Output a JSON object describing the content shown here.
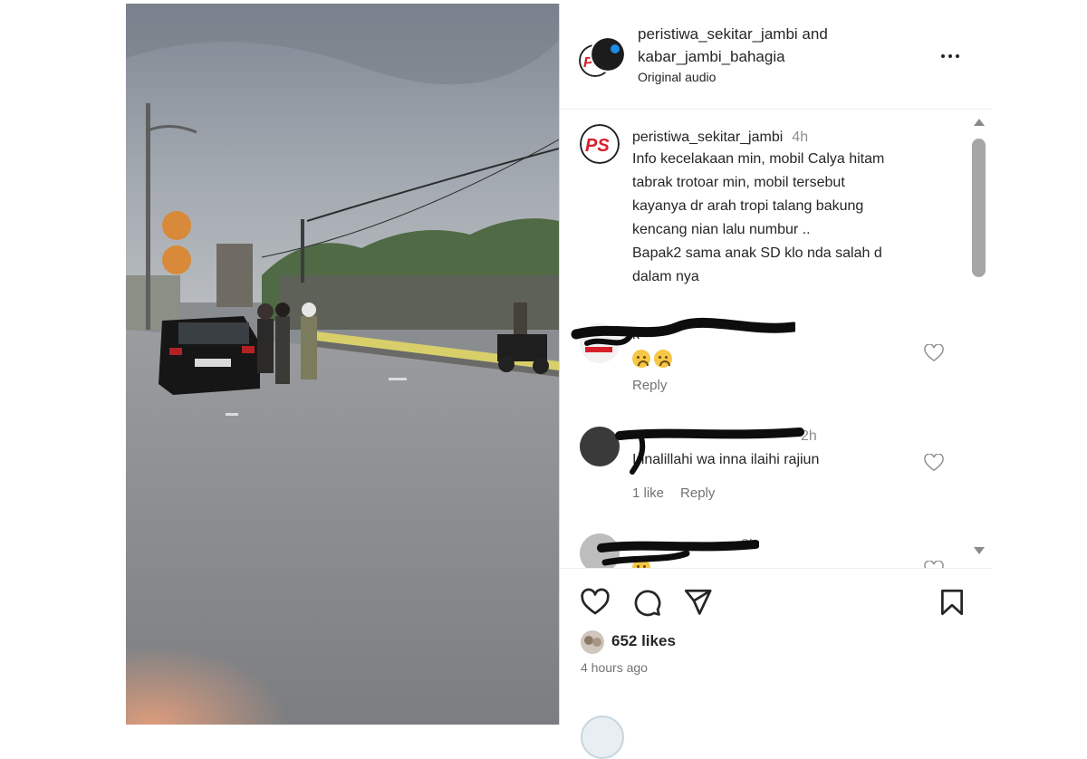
{
  "header": {
    "usernames_line1": "peristiwa_sekitar_jambi and",
    "usernames_line2": "kabar_jambi_bahagia",
    "audio": "Original audio",
    "avatar_logo": "PS",
    "more_icon": "more-horizontal-icon"
  },
  "caption": {
    "username": "peristiwa_sekitar_jambi",
    "time": "4h",
    "lines": [
      "Info kecelakaan min, mobil Calya hitam",
      "tabrak trotoar min, mobil tersebut",
      "kayanya dr arah tropi talang bakung",
      "kencang nian lalu numbur ..",
      "Bapak2 sama anak SD klo nda salah d",
      "dalam nya"
    ]
  },
  "comments": [
    {
      "username_visible": "k",
      "emoji_count": 2,
      "reply_label": "Reply"
    },
    {
      "time": "2h",
      "text": "Innalillahi wa inna ilaihi rajiun",
      "likes_label": "1 like",
      "reply_label": "Reply"
    },
    {
      "time": "3h",
      "emoji_count": 1
    }
  ],
  "actions": {
    "like_icon": "heart-icon",
    "comment_icon": "comment-icon",
    "share_icon": "send-icon",
    "save_icon": "bookmark-icon"
  },
  "likes_count": "652 likes",
  "posted_ago": "4 hours ago",
  "colors": {
    "text": "#262626",
    "secondary": "#737373",
    "logo_red": "#d6202a",
    "scrollbar": "#a6a6a6"
  }
}
